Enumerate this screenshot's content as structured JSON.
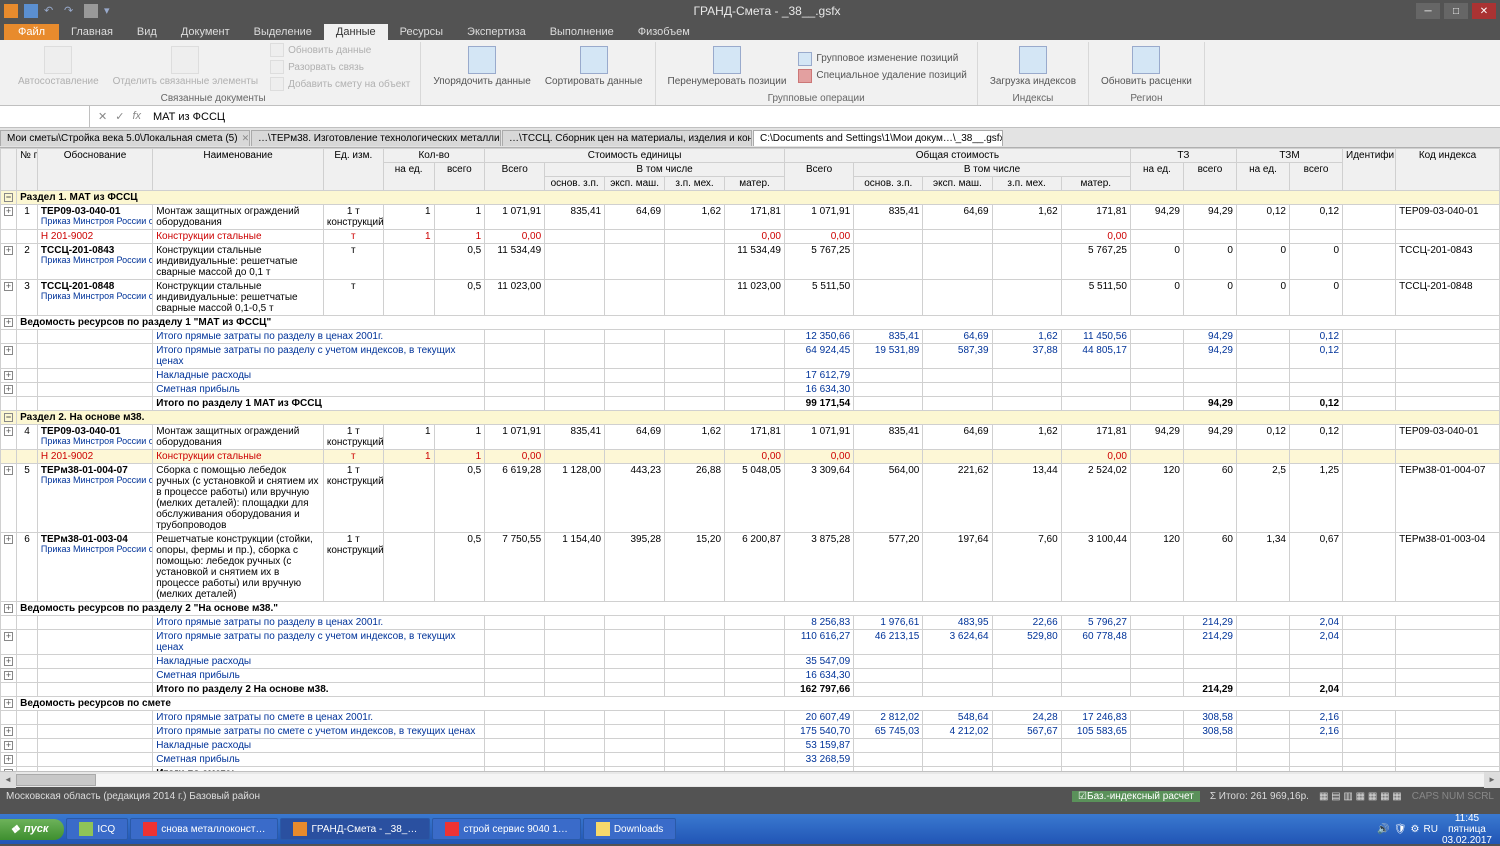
{
  "window": {
    "title": "ГРАНД-Смета - _38__.gsfx"
  },
  "tabs": {
    "file": "Файл",
    "items": [
      "Главная",
      "Вид",
      "Документ",
      "Выделение",
      "Данные",
      "Ресурсы",
      "Экспертиза",
      "Выполнение",
      "Физобъем"
    ],
    "active": 4
  },
  "ribbon": {
    "g1": {
      "label": "Связанные документы",
      "btn1": "Автосоставление",
      "btn2": "Отделить связанные\nэлементы",
      "btn3": "Обновить данные",
      "btn4": "Разорвать связь",
      "btn5": "Добавить смету на объект"
    },
    "g2": {
      "label": "",
      "btn1": "Упорядочить\nданные",
      "btn2": "Сортировать\nданные"
    },
    "g3": {
      "label": "Групповые операции",
      "btn1": "Перенумеровать\nпозиции",
      "btn2": "Групповое изменение позиций",
      "btn3": "Специальное удаление позиций"
    },
    "g4": {
      "label": "Индексы",
      "btn1": "Загрузка\nиндексов"
    },
    "g5": {
      "label": "Регион",
      "btn1": "Обновить\nрасценки"
    }
  },
  "formula": {
    "value": "МАТ из ФССЦ"
  },
  "docTabs": [
    {
      "label": "Мои сметы\\Стройка века 5.0\\Локальная смета (5)",
      "active": false
    },
    {
      "label": "…\\ТЕРм38. Изготовление технологических металлич…",
      "active": false
    },
    {
      "label": "…\\ТССЦ. Сборник цен на материалы, изделия и конс…",
      "active": false
    },
    {
      "label": "C:\\Documents and Settings\\1\\Мои докум…\\_38__.gsfx",
      "active": true
    }
  ],
  "headers": {
    "n": "№\nп.п",
    "code": "Обоснование",
    "name": "Наименование",
    "unit": "Ед. изм.",
    "qty": "Кол-во",
    "qtyE": "на ед.",
    "qtyT": "всего",
    "ucost": "Стоимость единицы",
    "uAll": "Всего",
    "uSub": "В том числе",
    "uZp": "основ. з.п.",
    "uEm": "эксп. маш.",
    "uZpm": "з.п. мех.",
    "uMat": "матер.",
    "tcost": "Общая стоимость",
    "tAll": "Всего",
    "tSub": "В том числе",
    "tZp": "основ. з.п.",
    "tEm": "эксп. маш.",
    "tZpm": "з.п. мех.",
    "tMat": "матер.",
    "tz": "ТЗ",
    "tzE": "на ед.",
    "tzT": "всего",
    "tzm": "ТЗМ",
    "tzmE": "на ед.",
    "tzmT": "всего",
    "id": "Идентифи\nкатор",
    "idx": "Код\nиндекса"
  },
  "sec1": {
    "title": "Раздел 1. МАТ из ФССЦ"
  },
  "r1": {
    "n": "1",
    "code": "ТЕР09-03-040-01",
    "src": "Приказ Минстроя России\nот 21.09.15 №675/пр",
    "name": "Монтаж защитных ограждений оборудования",
    "unit": "1 т\nконструкций",
    "qe": "1",
    "qt": "1",
    "uall": "1 071,91",
    "uzp": "835,41",
    "uem": "64,69",
    "uzpm": "1,62",
    "umat": "171,81",
    "tall": "1 071,91",
    "tzp": "835,41",
    "tem": "64,69",
    "tzpm": "1,62",
    "tmat": "171,81",
    "tze": "94,29",
    "tzt": "94,29",
    "tzme": "0,12",
    "tzmt": "0,12",
    "idx": "ТЕР09-03-040-01"
  },
  "r1h": {
    "code": "Н              201-9002",
    "name": "Конструкции стальные",
    "unit": "т",
    "qe": "1",
    "qt": "1",
    "uall": "0,00",
    "umat": "0,00",
    "tall": "0,00",
    "tmat": "0,00"
  },
  "r2": {
    "n": "2",
    "code": "ТССЦ-201-0843",
    "src": "Приказ Минстроя России\nот 21.09.15 №675/пр",
    "name": "Конструкции стальные индивидуальные: решетчатые сварные массой до 0,1 т",
    "unit": "т",
    "qt": "0,5",
    "uall": "11 534,49",
    "umat": "11 534,49",
    "tall": "5 767,25",
    "tmat": "5 767,25",
    "tzt": "0",
    "tzmt": "0",
    "tze": "0",
    "tzme": "0",
    "idx": "ТССЦ-201-0843"
  },
  "r3": {
    "n": "3",
    "code": "ТССЦ-201-0848",
    "src": "Приказ Минстроя России\nот 21.09.15 №675/пр",
    "name": "Конструкции стальные индивидуальные: решетчатые сварные массой 0,1-0,5 т",
    "unit": "т",
    "qt": "0,5",
    "uall": "11 023,00",
    "umat": "11 023,00",
    "tall": "5 511,50",
    "tmat": "5 511,50",
    "tzt": "0",
    "tzmt": "0",
    "tze": "0",
    "tzme": "0",
    "idx": "ТССЦ-201-0848"
  },
  "ved1": {
    "title": "Ведомость ресурсов по разделу 1 \"МАТ из ФССЦ\"",
    "l1": "Итого прямые затраты по разделу в ценах 2001г.",
    "l2": "Итого прямые затраты по разделу с учетом индексов, в текущих ценах",
    "l3": "Накладные расходы",
    "l4": "Сметная прибыль",
    "l5": "Итого по разделу 1 МАТ из ФССЦ",
    "v1": {
      "tall": "12 350,66",
      "tzp": "835,41",
      "tem": "64,69",
      "tzpm": "1,62",
      "tmat": "11 450,56",
      "tzt": "94,29",
      "tzmt": "0,12"
    },
    "v2": {
      "tall": "64 924,45",
      "tzp": "19 531,89",
      "tem": "587,39",
      "tzpm": "37,88",
      "tmat": "44 805,17",
      "tzt": "94,29",
      "tzmt": "0,12"
    },
    "v3": {
      "tall": "17 612,79"
    },
    "v4": {
      "tall": "16 634,30"
    },
    "v5": {
      "tall": "99 171,54",
      "tzt": "94,29",
      "tzmt": "0,12"
    }
  },
  "sec2": {
    "title": "Раздел 2. На основе м38."
  },
  "r4": {
    "n": "4",
    "code": "ТЕР09-03-040-01",
    "src": "Приказ Минстроя России\nот 21.09.15 №675/пр",
    "name": "Монтаж защитных ограждений оборудования",
    "unit": "1 т\nконструкций",
    "qe": "1",
    "qt": "1",
    "uall": "1 071,91",
    "uzp": "835,41",
    "uem": "64,69",
    "uzpm": "1,62",
    "umat": "171,81",
    "tall": "1 071,91",
    "tzp": "835,41",
    "tem": "64,69",
    "tzpm": "1,62",
    "tmat": "171,81",
    "tze": "94,29",
    "tzt": "94,29",
    "tzme": "0,12",
    "tzmt": "0,12",
    "idx": "ТЕР09-03-040-01"
  },
  "r4h": {
    "code": "Н              201-9002",
    "name": "Конструкции стальные",
    "unit": "т",
    "qe": "1",
    "qt": "1",
    "uall": "0,00",
    "umat": "0,00",
    "tall": "0,00",
    "tmat": "0,00"
  },
  "r5": {
    "n": "5",
    "code": "ТЕРм38-01-004-07",
    "src": "Приказ Минстроя России\nот 21.09.15 №675/пр",
    "name": "Сборка с помощью лебедок ручных (с установкой и снятием их в процессе работы) или вручную (мелких деталей): площадки для обслуживания оборудования и трубопроводов",
    "unit": "1 т\nконструкций",
    "qt": "0,5",
    "uall": "6 619,28",
    "uzp": "1 128,00",
    "uem": "443,23",
    "uzpm": "26,88",
    "umat": "5 048,05",
    "tall": "3 309,64",
    "tzp": "564,00",
    "tem": "221,62",
    "tzpm": "13,44",
    "tmat": "2 524,02",
    "tze": "120",
    "tzt": "60",
    "tzme": "2,5",
    "tzmt": "1,25",
    "idx": "ТЕРм38-01-004-07"
  },
  "r6": {
    "n": "6",
    "code": "ТЕРм38-01-003-04",
    "src": "Приказ Минстроя России\nот 21.09.15 №675/пр",
    "name": "Решетчатые конструкции (стойки, опоры, фермы и пр.), сборка с помощью: лебедок ручных (с установкой и снятием их в процессе работы) или вручную (мелких деталей)",
    "unit": "1 т\nконструкций",
    "qt": "0,5",
    "uall": "7 750,55",
    "uzp": "1 154,40",
    "uem": "395,28",
    "uzpm": "15,20",
    "umat": "6 200,87",
    "tall": "3 875,28",
    "tzp": "577,20",
    "tem": "197,64",
    "tzpm": "7,60",
    "tmat": "3 100,44",
    "tze": "120",
    "tzt": "60",
    "tzme": "1,34",
    "tzmt": "0,67",
    "idx": "ТЕРм38-01-003-04"
  },
  "ved2": {
    "title": "Ведомость ресурсов по разделу 2 \"На основе м38.\"",
    "l1": "Итого прямые затраты по разделу в ценах 2001г.",
    "l2": "Итого прямые затраты по разделу с учетом индексов, в текущих ценах",
    "l3": "Накладные расходы",
    "l4": "Сметная прибыль",
    "l5": "Итого по разделу 2 На основе м38.",
    "v1": {
      "tall": "8 256,83",
      "tzp": "1 976,61",
      "tem": "483,95",
      "tzpm": "22,66",
      "tmat": "5 796,27",
      "tzt": "214,29",
      "tzmt": "2,04"
    },
    "v2": {
      "tall": "110 616,27",
      "tzp": "46 213,15",
      "tem": "3 624,64",
      "tzpm": "529,80",
      "tmat": "60 778,48",
      "tzt": "214,29",
      "tzmt": "2,04"
    },
    "v3": {
      "tall": "35 547,09"
    },
    "v4": {
      "tall": "16 634,30"
    },
    "v5": {
      "tall": "162 797,66",
      "tzt": "214,29",
      "tzmt": "2,04"
    }
  },
  "vedS": {
    "title": "Ведомость ресурсов по смете",
    "l1": "Итого прямые затраты по смете в ценах 2001г.",
    "l2": "Итого прямые затраты по смете с учетом индексов, в текущих ценах",
    "l3": "Накладные расходы",
    "l4": "Сметная прибыль",
    "l5": "Итоги по смете:",
    "v1": {
      "tall": "20 607,49",
      "tzp": "2 812,02",
      "tem": "548,64",
      "tzpm": "24,28",
      "tmat": "17 246,83",
      "tzt": "308,58",
      "tzmt": "2,16"
    },
    "v2": {
      "tall": "175 540,70",
      "tzp": "65 745,03",
      "tem": "4 212,02",
      "tzpm": "567,67",
      "tmat": "105 583,65",
      "tzt": "308,58",
      "tzmt": "2,16"
    },
    "v3": {
      "tall": "53 159,87"
    },
    "v4": {
      "tall": "33 268,59"
    }
  },
  "status": {
    "left": "Московская область (редакция 2014 г.)   Базовый район",
    "calc": "Баз.-индексный расчет",
    "total": "Итого: 261 969,16р.",
    "caps": "CAPS  NUM  SCRL"
  },
  "taskbar": {
    "start": "пуск",
    "tasks": [
      {
        "label": "ICQ",
        "color": "#8fc357"
      },
      {
        "label": "снова металлоконст…",
        "color": "#e33"
      },
      {
        "label": "ГРАНД-Смета - _38_…",
        "color": "#e88b2d",
        "active": true
      },
      {
        "label": "строй сервис 9040 1…",
        "color": "#e33"
      },
      {
        "label": "Downloads",
        "color": "#f7d96b"
      }
    ],
    "lang": "RU",
    "time": "11:45",
    "day": "пятница",
    "date": "03.02.2017"
  }
}
